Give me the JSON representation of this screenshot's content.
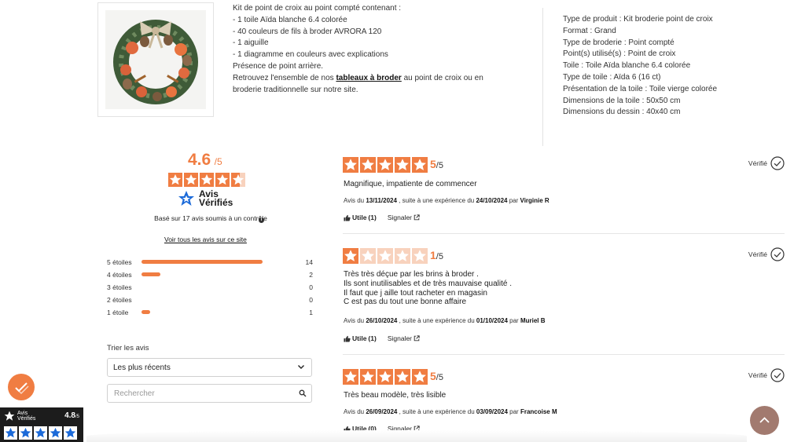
{
  "product": {
    "description_lines": [
      "Kit de point de croix au point compté contenant :",
      "- 1 toile Aïda blanche 6.4 colorée",
      "- 40 couleurs de fils à broder AVRORA 120",
      "- 1 aiguille",
      "- 1 diagramme en couleurs avec explications",
      "Présence de point arrière."
    ],
    "retrouvez_pre": "Retrouvez l'ensemble de nos ",
    "retrouvez_link": "tableaux à broder",
    "retrouvez_post": " au point de croix ou en",
    "retrouvez_line2": "broderie traditionnelle sur notre site.",
    "specs": [
      "Type de produit : Kit broderie point de croix",
      "Format : Grand",
      "Type de broderie : Point compté",
      "Point(s) utilisé(s) : Point de croix",
      "Toile : Toile Aïda blanche 6.4 colorée",
      "Type de toile : Aïda 6 (16 ct)",
      "Présentation de la toile : Toile vierge colorée",
      "Dimensions de la toile : 50x50 cm",
      "Dimensions du dessin : 40x40 cm"
    ]
  },
  "summary": {
    "score": "4.6",
    "score_suffix": "/5",
    "rating": 4.6,
    "brand_line1": "Avis",
    "brand_line2": "Vérifiés",
    "based_on": "Basé sur 17 avis soumis à un contrôle",
    "info_icon": "i",
    "see_all": "Voir tous les avis sur ce site",
    "distribution": [
      {
        "label": "5 étoiles",
        "count": "14",
        "fraction": 0.96
      },
      {
        "label": "4 étoiles",
        "count": "2",
        "fraction": 0.15
      },
      {
        "label": "3 étoiles",
        "count": "0",
        "fraction": 0
      },
      {
        "label": "2 étoiles",
        "count": "0",
        "fraction": 0
      },
      {
        "label": "1 étoile",
        "count": "1",
        "fraction": 0.07
      }
    ],
    "sort_title": "Trier les avis",
    "sort_value": "Les plus récents",
    "search_placeholder": "Rechercher"
  },
  "reviews": [
    {
      "rating": 5,
      "rating_text": "5",
      "out_of": "/5",
      "verified": "Vérifié",
      "body": [
        "Magnifique, impatiente de commencer"
      ],
      "meta_pre": "Avis du ",
      "review_date": "13/11/2024",
      "meta_mid": " , suite à une expérience du ",
      "experience_date": "24/10/2024",
      "meta_par": " par ",
      "author": "Virginie R",
      "useful_label": "Utile",
      "useful_count": "(1)",
      "report_label": "Signaler"
    },
    {
      "rating": 1,
      "rating_text": "1",
      "out_of": "/5",
      "verified": "Vérifié",
      "body": [
        "Très très déçue par les brins à broder .",
        "Ils sont inutilisables et de très mauvaise qualité  .",
        "Il faut que j aille tout racheter en magasin",
        "C est pas du tout une bonne affaire"
      ],
      "meta_pre": "Avis du ",
      "review_date": "26/10/2024",
      "meta_mid": " , suite à une expérience du ",
      "experience_date": "01/10/2024",
      "meta_par": " par ",
      "author": "Muriel B",
      "useful_label": "Utile",
      "useful_count": "(1)",
      "report_label": "Signaler"
    },
    {
      "rating": 5,
      "rating_text": "5",
      "out_of": "/5",
      "verified": "Vérifié",
      "body": [
        "Très beau modèle, très lisible"
      ],
      "meta_pre": "Avis du ",
      "review_date": "26/09/2024",
      "meta_mid": " , suite à une expérience du ",
      "experience_date": "03/09/2024",
      "meta_par": " par ",
      "author": "Francoise M",
      "useful_label": "Utile",
      "useful_count": "(0)",
      "report_label": "Signaler"
    }
  ],
  "widget": {
    "name_line1": "Avis",
    "name_line2": "Vérifiés",
    "score": "4.8",
    "suffix": "/5",
    "rating": 5
  },
  "colors": {
    "accent": "#f07d42",
    "accent_light": "#f8d2bd",
    "scroll_button": "#a27a6f",
    "widget_bg": "#1c1c1c",
    "brand_blue": "#1b6ad9"
  },
  "icons": {
    "product_image": "christmas-wreath-image",
    "brand_logo": "avis-verifies-logo-icon",
    "verified": "check-circle-icon",
    "useful": "thumbs-up-icon",
    "report": "external-link-icon",
    "sort": "chevron-down-icon",
    "search": "search-icon",
    "fab": "checkmark-fab-icon",
    "scroll_top": "chevron-up-icon"
  }
}
